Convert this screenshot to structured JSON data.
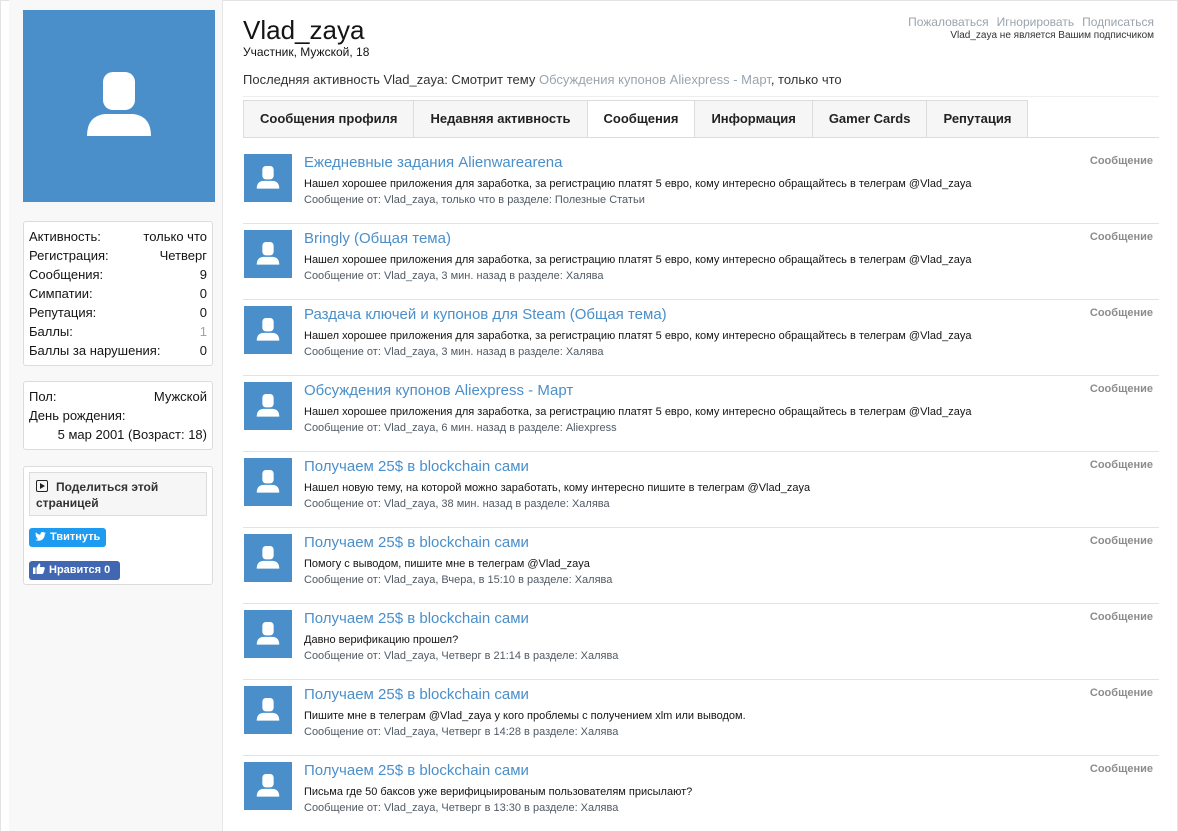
{
  "sidebar": {
    "stats": [
      {
        "label": "Активность:",
        "value": "только что"
      },
      {
        "label": "Регистрация:",
        "value": "Четверг"
      },
      {
        "label": "Сообщения:",
        "value": "9"
      },
      {
        "label": "Симпатии:",
        "value": "0"
      },
      {
        "label": "Репутация:",
        "value": "0"
      },
      {
        "label": "Баллы:",
        "value": "1"
      },
      {
        "label": "Баллы за нарушения:",
        "value": "0"
      }
    ],
    "personal": {
      "gender_label": "Пол:",
      "gender_value": "Мужской",
      "birthday_label": "День рождения:",
      "birthday_value": "5 мар 2001 (Возраст: 18)"
    },
    "share": {
      "title": "Поделиться этой страницей",
      "tweet_label": "Твитнуть",
      "like_label": "Нравится 0"
    }
  },
  "profile": {
    "username": "Vlad_zaya",
    "user_title": "Участник, Мужской, 18",
    "links": [
      "Пожаловаться",
      "Игнорировать",
      "Подписаться"
    ],
    "not_following": "Vlad_zaya не является Вашим подписчиком",
    "activity_prefix": "Последняя активность Vlad_zaya: Смотрит тему ",
    "activity_link": "Обсуждения купонов Aliexpress - Март",
    "activity_suffix": ", только что"
  },
  "tabs": [
    "Сообщения профиля",
    "Недавняя активность",
    "Сообщения",
    "Информация",
    "Gamer Cards",
    "Репутация"
  ],
  "active_tab": "Сообщения",
  "posts": [
    {
      "title": "Ежедневные задания Alienwarearena",
      "snippet": "Нашел хорошее приложения для заработка, за регистрацию платят 5 евро, кому интересно обращайтесь в телеграм @Vlad_zaya",
      "meta": "Сообщение от: Vlad_zaya, только что в разделе: Полезные Статьи",
      "kind": "Сообщение"
    },
    {
      "title": "Bringly (Общая тема)",
      "snippet": "Нашел хорошее приложения для заработка, за регистрацию платят 5 евро, кому интересно обращайтесь в телеграм @Vlad_zaya",
      "meta": "Сообщение от: Vlad_zaya, 3 мин. назад в разделе: Халява",
      "kind": "Сообщение"
    },
    {
      "title": "Раздача ключей и купонов для Steam (Общая тема)",
      "snippet": "Нашел хорошее приложения для заработка, за регистрацию платят 5 евро, кому интересно обращайтесь в телеграм @Vlad_zaya",
      "meta": "Сообщение от: Vlad_zaya, 3 мин. назад в разделе: Халява",
      "kind": "Сообщение"
    },
    {
      "title": "Обсуждения купонов Aliexpress - Март",
      "snippet": "Нашел хорошее приложения для заработка, за регистрацию платят 5 евро, кому интересно обращайтесь в телеграм @Vlad_zaya",
      "meta": "Сообщение от: Vlad_zaya, 6 мин. назад в разделе: Aliexpress",
      "kind": "Сообщение"
    },
    {
      "title": "Получаем 25$ в blockchain сами",
      "snippet": "Нашел новую тему, на которой можно заработать, кому интересно пишите в телеграм @Vlad_zaya",
      "meta": "Сообщение от: Vlad_zaya, 38 мин. назад в разделе: Халява",
      "kind": "Сообщение"
    },
    {
      "title": "Получаем 25$ в blockchain сами",
      "snippet": "Помогу с выводом, пишите мне в телеграм @Vlad_zaya",
      "meta": "Сообщение от: Vlad_zaya, Вчера, в 15:10 в разделе: Халява",
      "kind": "Сообщение"
    },
    {
      "title": "Получаем 25$ в blockchain сами",
      "snippet": "Давно верификацию прошел?",
      "meta": "Сообщение от: Vlad_zaya, Четверг в 21:14 в разделе: Халява",
      "kind": "Сообщение"
    },
    {
      "title": "Получаем 25$ в blockchain сами",
      "snippet": "Пишите мне в телеграм @Vlad_zaya у кого проблемы с получением xlm или выводом.",
      "meta": "Сообщение от: Vlad_zaya, Четверг в 14:28 в разделе: Халява",
      "kind": "Сообщение"
    },
    {
      "title": "Получаем 25$ в blockchain сами",
      "snippet": "Письма где 50 баксов уже верифицыированым пользователям присылают?",
      "meta": "Сообщение от: Vlad_zaya, Четверг в 13:30 в разделе: Халява",
      "kind": "Сообщение"
    }
  ],
  "colors": {
    "accent": "#4a8fca",
    "muted": "#9aa4ae",
    "twitter": "#1d9bf0",
    "facebook": "#4267b2"
  },
  "icons": {
    "avatar": "user-silhouette-icon",
    "share": "play-square-icon",
    "twitter": "twitter-bird-icon",
    "facebook": "thumbs-up-icon"
  }
}
